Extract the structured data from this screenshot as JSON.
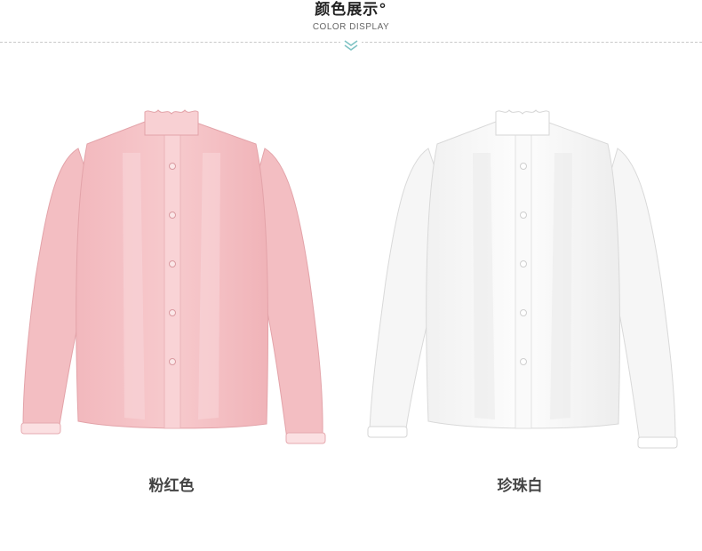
{
  "header": {
    "title": "颜色展示°",
    "subtitle": "COLOR DISPLAY",
    "divider_icon": "double-chevron-down-icon"
  },
  "colors": {
    "pink_shirt": "#f6c5c8",
    "pink_shadow": "#e8a7ad",
    "white_shirt": "#fbfbfb",
    "white_shadow": "#dcdcdc",
    "chevron": "#7fc3c4"
  },
  "products": [
    {
      "label": "粉红色",
      "color_name": "pink"
    },
    {
      "label": "珍珠白",
      "color_name": "pearl-white"
    }
  ]
}
